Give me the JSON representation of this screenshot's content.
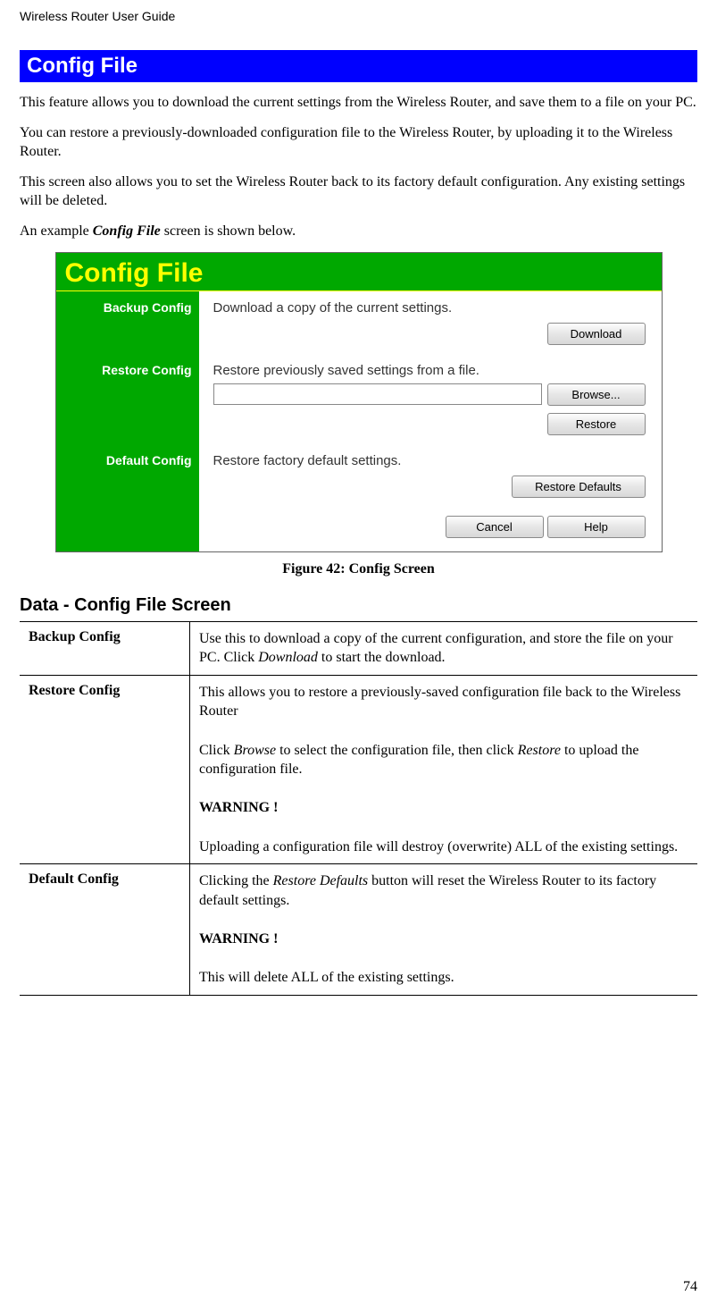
{
  "header": {
    "running_title": "Wireless Router User Guide",
    "page_number": "74"
  },
  "section": {
    "title": "Config File",
    "paragraphs": [
      "This feature allows you to download the current settings from the Wireless Router, and save them to a file on your PC.",
      "You can restore a previously-downloaded configuration file to the Wireless Router, by uploading it to the Wireless Router.",
      "This screen also allows you to set the Wireless Router back to its factory default configuration. Any existing settings will be deleted."
    ],
    "example_line_pre": "An example ",
    "example_line_em": "Config File",
    "example_line_post": " screen is shown below."
  },
  "figure": {
    "title": "Config File",
    "rows": {
      "backup": {
        "label": "Backup Config",
        "text": "Download a copy of the current settings.",
        "button": "Download"
      },
      "restore": {
        "label": "Restore Config",
        "text": "Restore previously saved settings from a file.",
        "browse": "Browse...",
        "button": "Restore"
      },
      "default": {
        "label": "Default Config",
        "text": "Restore factory default settings.",
        "button": "Restore Defaults"
      }
    },
    "bottom_buttons": {
      "cancel": "Cancel",
      "help": "Help"
    },
    "caption": "Figure 42: Config Screen"
  },
  "data_table": {
    "heading": "Data - Config File Screen",
    "rows": [
      {
        "name": "Backup Config",
        "html": "Use this to download a copy of the current configuration, and store the file on your PC. Click <i>Download</i> to start the download."
      },
      {
        "name": "Restore Config",
        "html": "This allows you to restore a previously-saved configuration file back to the Wireless Router<br><br>Click <i>Browse</i> to select the configuration file, then click <i>Restore</i> to upload the configuration file.<br><br><b>WARNING !</b><br><br>Uploading a configuration file will destroy (overwrite) ALL of the existing settings."
      },
      {
        "name": "Default Config",
        "html": "Clicking the <i>Restore Defaults</i> button will reset the Wireless Router to its factory default settings.<br><br><b>WARNING !</b><br><br>This will delete ALL of the existing settings."
      }
    ]
  }
}
